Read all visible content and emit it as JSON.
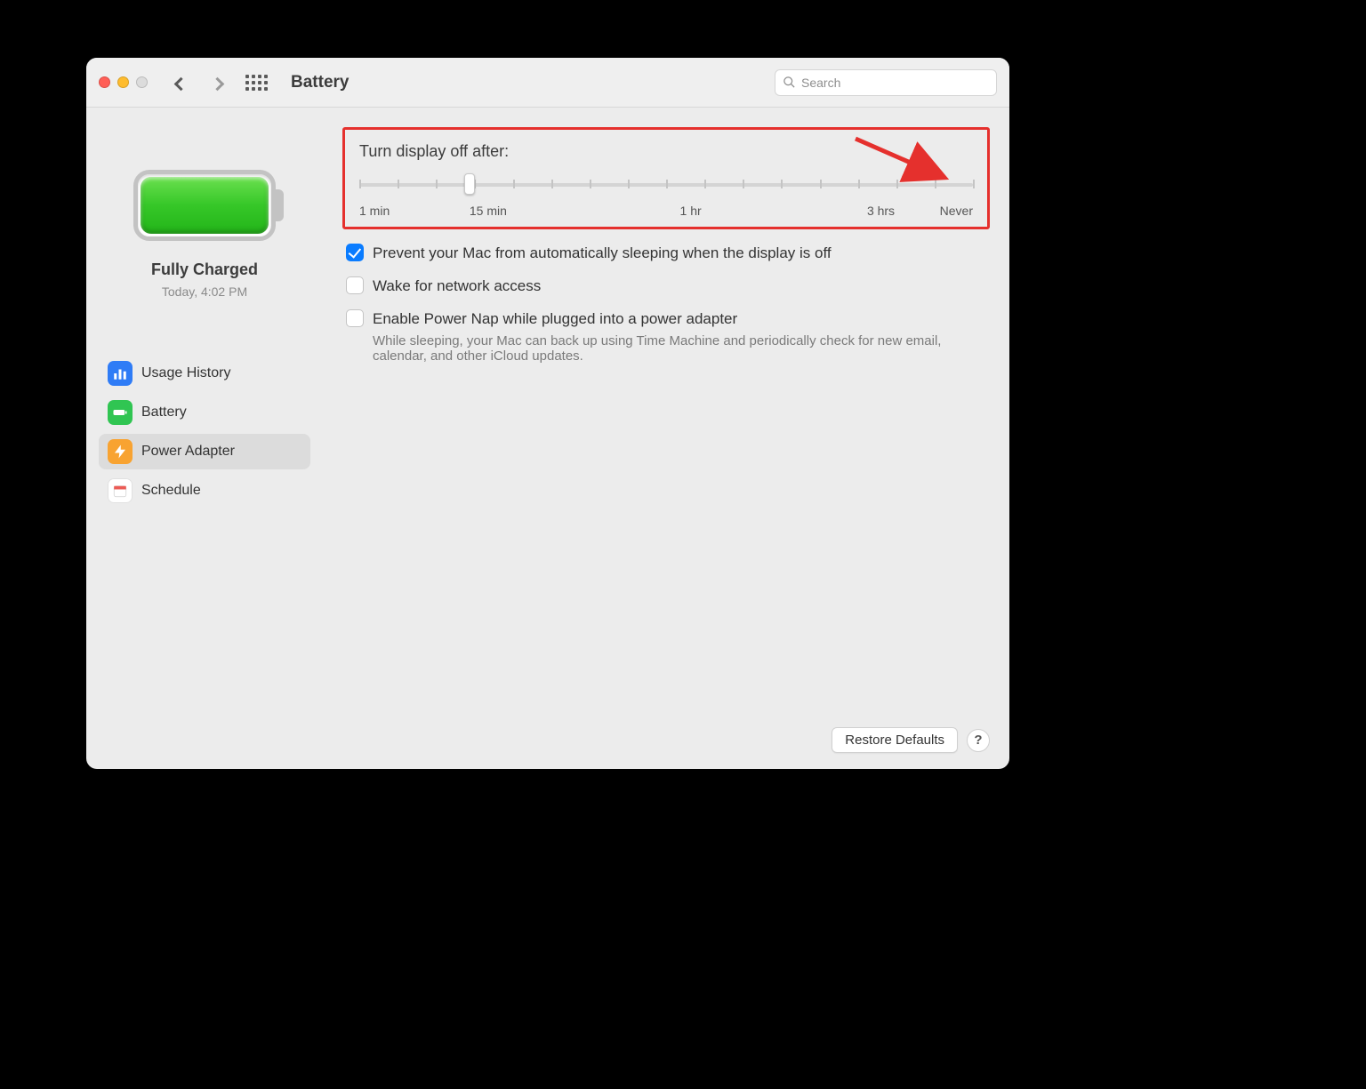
{
  "window": {
    "title": "Battery",
    "search_placeholder": "Search"
  },
  "sidebar": {
    "status_title": "Fully Charged",
    "status_time": "Today, 4:02 PM",
    "items": [
      {
        "label": "Usage History",
        "icon": "usage-history-icon",
        "color": "blue",
        "selected": false
      },
      {
        "label": "Battery",
        "icon": "battery-icon",
        "color": "green",
        "selected": false
      },
      {
        "label": "Power Adapter",
        "icon": "power-adapter-icon",
        "color": "orange",
        "selected": true
      },
      {
        "label": "Schedule",
        "icon": "schedule-icon",
        "color": "white",
        "selected": false
      }
    ]
  },
  "main": {
    "slider": {
      "title": "Turn display off after:",
      "labels": [
        "1 min",
        "15 min",
        "1 hr",
        "3 hrs",
        "Never"
      ],
      "ticks": 16,
      "thumb_pos_pct": 18
    },
    "checks": [
      {
        "label": "Prevent your Mac from automatically sleeping when the display is off",
        "checked": true,
        "desc": ""
      },
      {
        "label": "Wake for network access",
        "checked": false,
        "desc": ""
      },
      {
        "label": "Enable Power Nap while plugged into a power adapter",
        "checked": false,
        "desc": "While sleeping, your Mac can back up using Time Machine and periodically check for new email, calendar, and other iCloud updates."
      }
    ],
    "restore_label": "Restore Defaults",
    "help_label": "?"
  },
  "annotation": {
    "highlight_box": true,
    "arrow_to": "never"
  },
  "colors": {
    "highlight": "#e5302d",
    "accent": "#0a7cff"
  }
}
